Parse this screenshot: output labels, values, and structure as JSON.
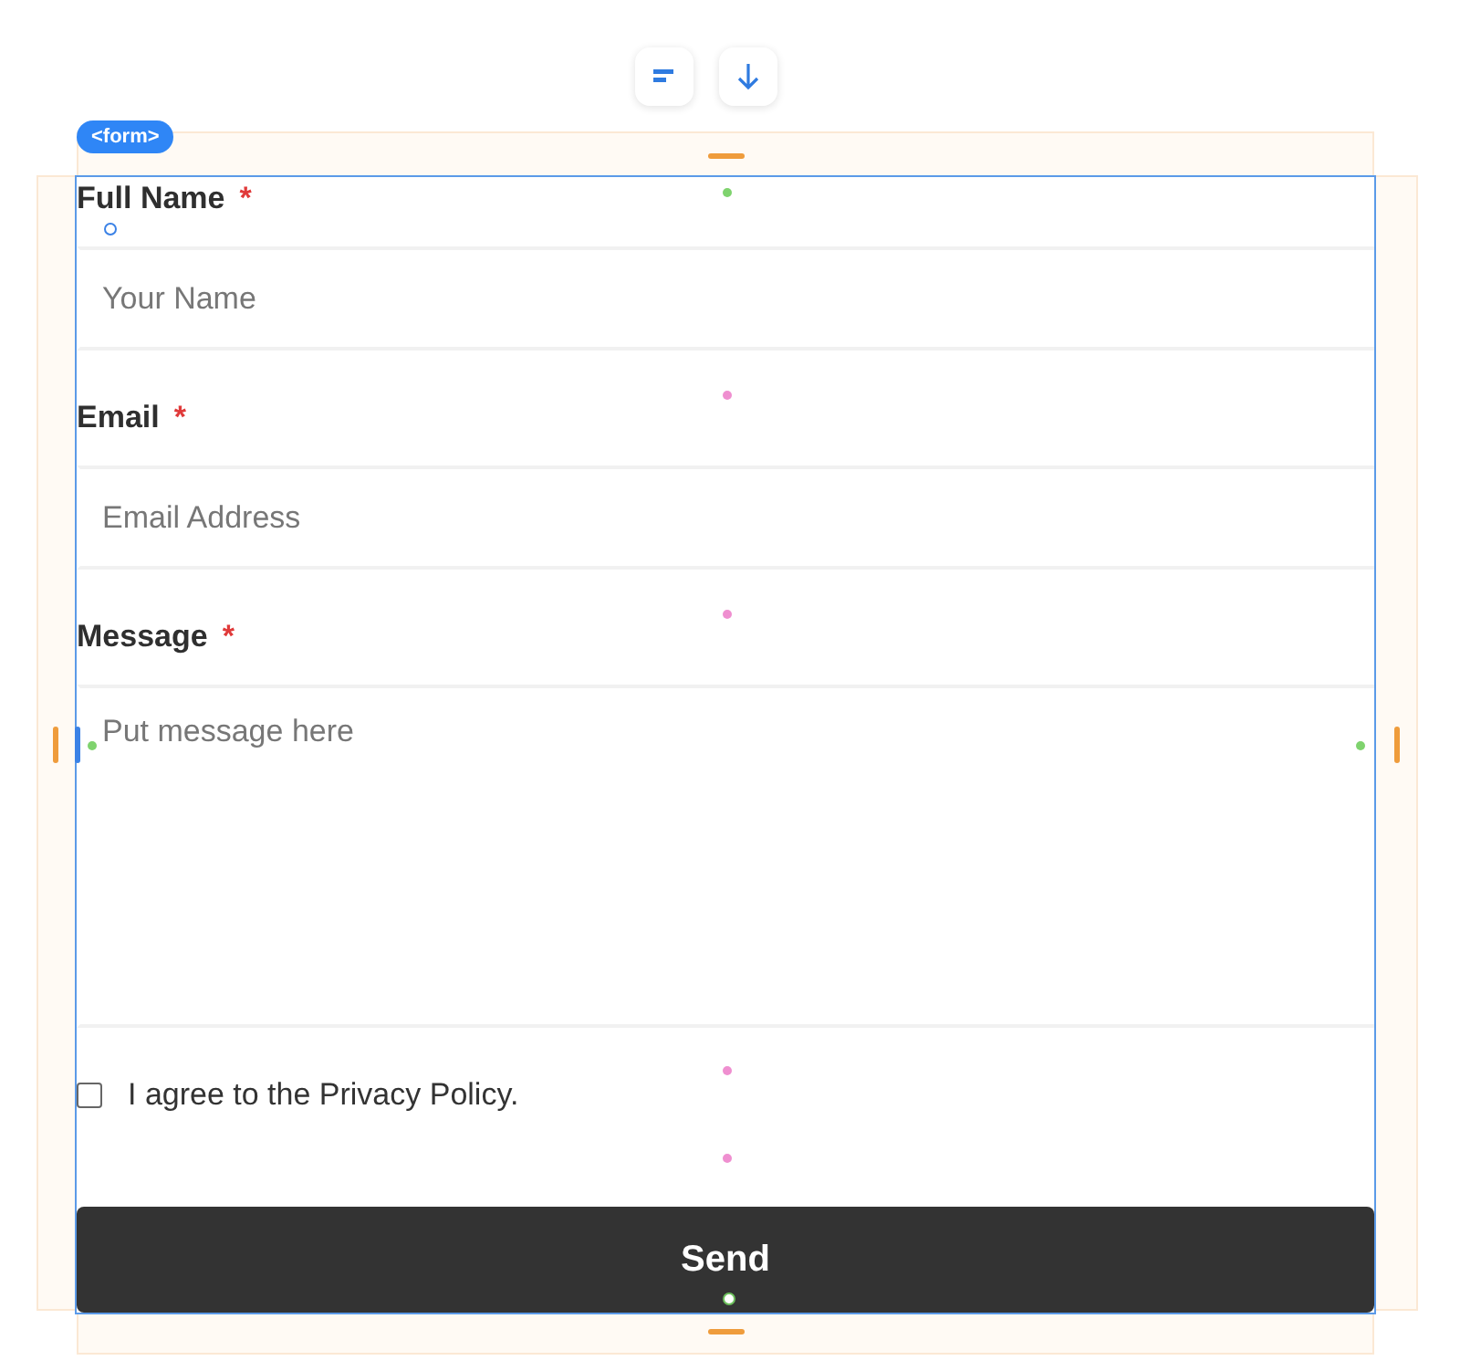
{
  "toolbar": [
    {
      "kind": "align"
    },
    {
      "kind": "arrow-down"
    }
  ],
  "element_badge": "<form>",
  "fields": [
    {
      "kind": "input",
      "label": "Full Name",
      "required": true,
      "required_mark": "*",
      "placeholder": "Your Name"
    },
    {
      "kind": "input",
      "label": "Email",
      "required": true,
      "required_mark": "*",
      "placeholder": "Email Address"
    },
    {
      "kind": "textarea",
      "label": "Message",
      "required": true,
      "required_mark": "*",
      "placeholder": "Put message here"
    }
  ],
  "consent": {
    "label": "I agree to the Privacy Policy.",
    "checked": false
  },
  "submit": {
    "label": "Send"
  }
}
